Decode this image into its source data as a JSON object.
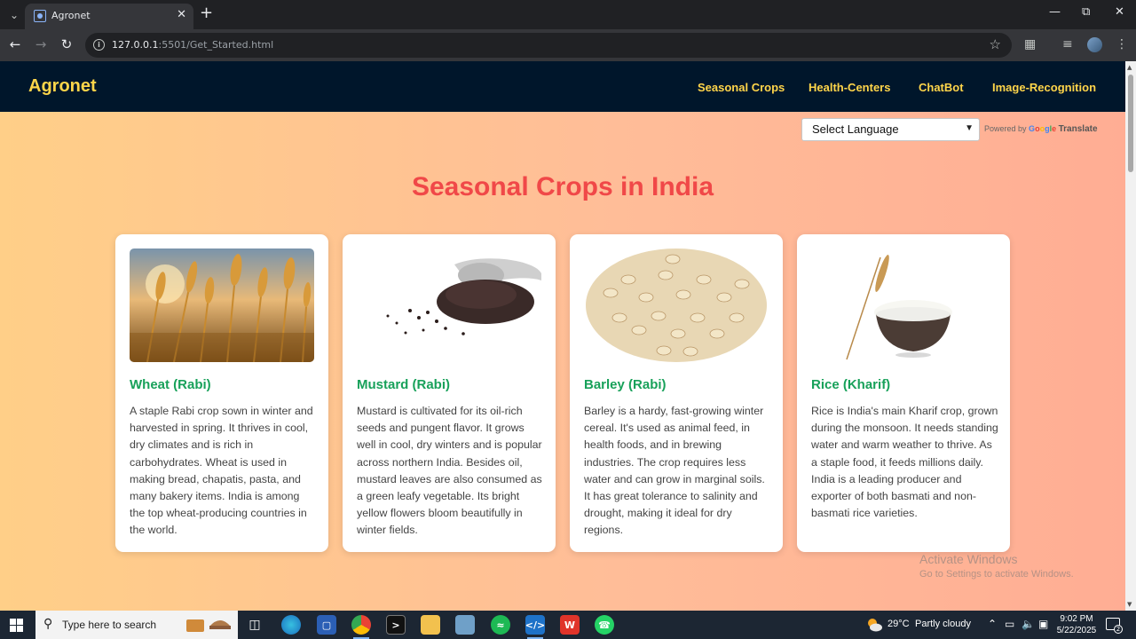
{
  "browser": {
    "tab_title": "Agronet",
    "url_host": "127.0.0.1",
    "url_rest": ":5501/Get_Started.html"
  },
  "site": {
    "brand": "Agronet",
    "nav": [
      "Seasonal Crops",
      "Health-Centers",
      "ChatBot",
      "Image-Recognition"
    ],
    "language_select": "Select Language",
    "powered_by": "Powered by",
    "google": "Google",
    "translate": "Translate",
    "title": "Seasonal Crops in India"
  },
  "crops": [
    {
      "name": "Wheat (Rabi)",
      "description": "A staple Rabi crop sown in winter and harvested in spring. It thrives in cool, dry climates and is rich in carbohydrates. Wheat is used in making bread, chapatis, pasta, and many bakery items. India is among the top wheat-producing countries in the world."
    },
    {
      "name": "Mustard (Rabi)",
      "description": "Mustard is cultivated for its oil-rich seeds and pungent flavor. It grows well in cool, dry winters and is popular across northern India. Besides oil, mustard leaves are also consumed as a green leafy vegetable. Its bright yellow flowers bloom beautifully in winter fields."
    },
    {
      "name": "Barley (Rabi)",
      "description": "Barley is a hardy, fast-growing winter cereal. It's used as animal feed, in health foods, and in brewing industries. The crop requires less water and can grow in marginal soils. It has great tolerance to salinity and drought, making it ideal for dry regions."
    },
    {
      "name": "Rice (Kharif)",
      "description": "Rice is India's main Kharif crop, grown during the monsoon. It needs standing water and warm weather to thrive. As a staple food, it feeds millions daily. India is a leading producer and exporter of both basmati and non-basmati rice varieties."
    }
  ],
  "watermark": {
    "line1": "Activate Windows",
    "line2": "Go to Settings to activate Windows."
  },
  "taskbar": {
    "search_placeholder": "Type here to search",
    "temperature": "29°C",
    "weather": "Partly cloudy",
    "time": "9:02 PM",
    "date": "5/22/2025",
    "notification_count": "2"
  },
  "colors": {
    "header_bg": "#00162b",
    "brand": "#ffd54a",
    "title": "#f04848",
    "crop_name": "#18a15a"
  }
}
